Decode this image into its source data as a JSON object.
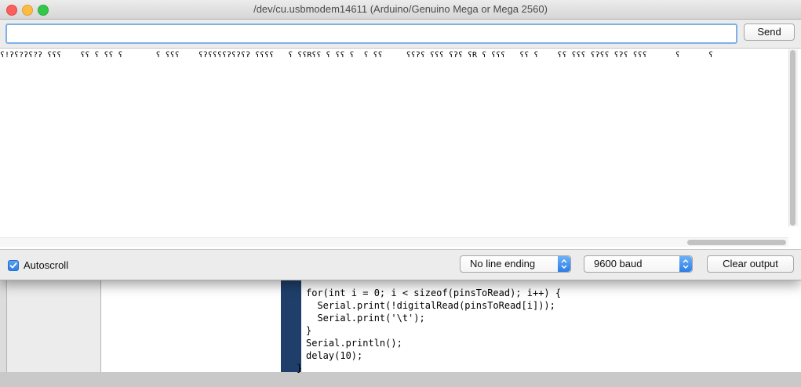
{
  "window": {
    "title": "/dev/cu.usbmodem14611 (Arduino/Genuino Mega or Mega 2560)"
  },
  "input": {
    "value": "",
    "placeholder": ""
  },
  "buttons": {
    "send": "Send",
    "clear_output": "Clear output"
  },
  "output": {
    "text": "ʕ!ʔʕ?ʔʕ?ʔ ʕʕʕ    ʕʕ ʕ ʕʕ ʕ       ʕ ʕʕʕ    ʕʔʕʕʕʕʔʕʔʕʔ ʕʕʕʕ   ʕ ʕʕRʕʕ ʕ ʕʕ ʕ  ʕ ʕʕ     ʕʕʔʕ ʕʕʕ ʕʔʕ ʕR ʕ ʕʕʕ   ʕʕ ʕ    ʕʕ ʕʕʕ ʕʔʕʕ ʕʔʕ ʕʕʕ      ʕ      ʕ"
  },
  "footer": {
    "autoscroll_label": "Autoscroll",
    "autoscroll_checked": true,
    "line_ending": "No line ending",
    "baud": "9600 baud"
  },
  "background_code": {
    "lines": [
      "for(int i = 0; i < sizeof(pinsToRead); i++) {",
      "  Serial.print(!digitalRead(pinsToRead[i]));",
      "  Serial.print('\\t');",
      "}",
      "Serial.println();",
      "delay(10);",
      "}"
    ]
  },
  "colors": {
    "accent": "#2c7de7",
    "close": "#fc605c",
    "minimize": "#fdbc40",
    "maximize": "#34c84a",
    "editor_gutter": "#1f3f6a"
  }
}
